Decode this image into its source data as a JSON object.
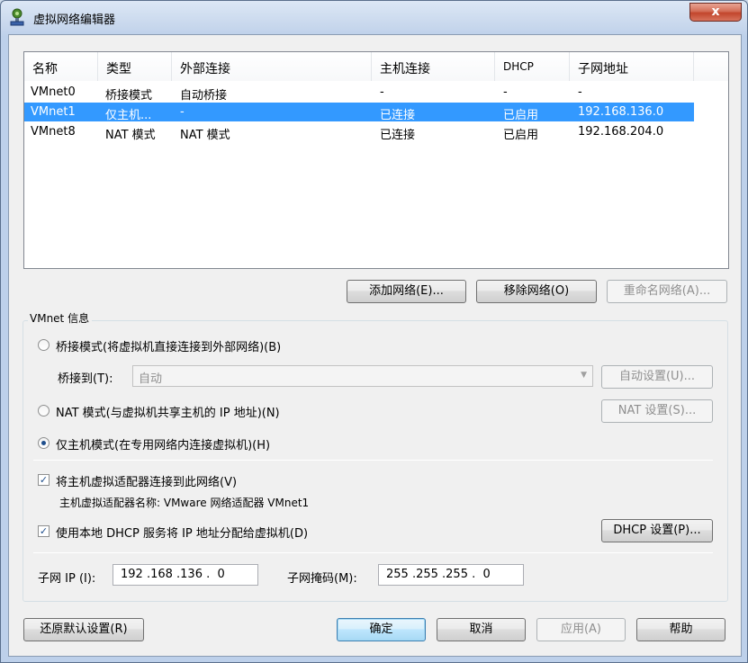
{
  "window": {
    "title": "虚拟网络编辑器",
    "close_glyph": "x"
  },
  "table": {
    "columns": [
      "名称",
      "类型",
      "外部连接",
      "主机连接",
      "DHCP",
      "子网地址"
    ],
    "rows": [
      {
        "name": "VMnet0",
        "type": "桥接模式",
        "external": "自动桥接",
        "host": "-",
        "dhcp": "-",
        "subnet": "-"
      },
      {
        "name": "VMnet1",
        "type": "仅主机...",
        "external": "-",
        "host": "已连接",
        "dhcp": "已启用",
        "subnet": "192.168.136.0"
      },
      {
        "name": "VMnet8",
        "type": "NAT 模式",
        "external": "NAT 模式",
        "host": "已连接",
        "dhcp": "已启用",
        "subnet": "192.168.204.0"
      }
    ],
    "selected_index": 1
  },
  "buttons": {
    "add_network": "添加网络(E)...",
    "remove_network": "移除网络(O)",
    "rename_network": "重命名网络(A)...",
    "auto_settings": "自动设置(U)...",
    "nat_settings": "NAT 设置(S)...",
    "dhcp_settings": "DHCP 设置(P)...",
    "restore_defaults": "还原默认设置(R)",
    "ok": "确定",
    "cancel": "取消",
    "apply": "应用(A)",
    "help": "帮助"
  },
  "vmnet_info": {
    "group_label": "VMnet 信息",
    "bridged_label": "桥接模式(将虚拟机直接连接到外部网络)(B)",
    "bridge_to_label": "桥接到(T):",
    "bridge_to_value": "自动",
    "nat_label": "NAT 模式(与虚拟机共享主机的 IP 地址)(N)",
    "hostonly_label": "仅主机模式(在专用网络内连接虚拟机)(H)",
    "selected_mode": "hostonly",
    "connect_adapter_label": "将主机虚拟适配器连接到此网络(V)",
    "adapter_name_label": "主机虚拟适配器名称: VMware 网络适配器 VMnet1",
    "use_dhcp_label": "使用本地 DHCP 服务将 IP 地址分配给虚拟机(D)",
    "connect_adapter_checked": true,
    "use_dhcp_checked": true,
    "subnet_ip_label": "子网 IP (I):",
    "subnet_ip_value": "192 .168 .136 .  0",
    "subnet_mask_label": "子网掩码(M):",
    "subnet_mask_value": "255 .255 .255 .  0"
  },
  "colors": {
    "selection": "#3399ff",
    "close_button": "#c2452c"
  }
}
